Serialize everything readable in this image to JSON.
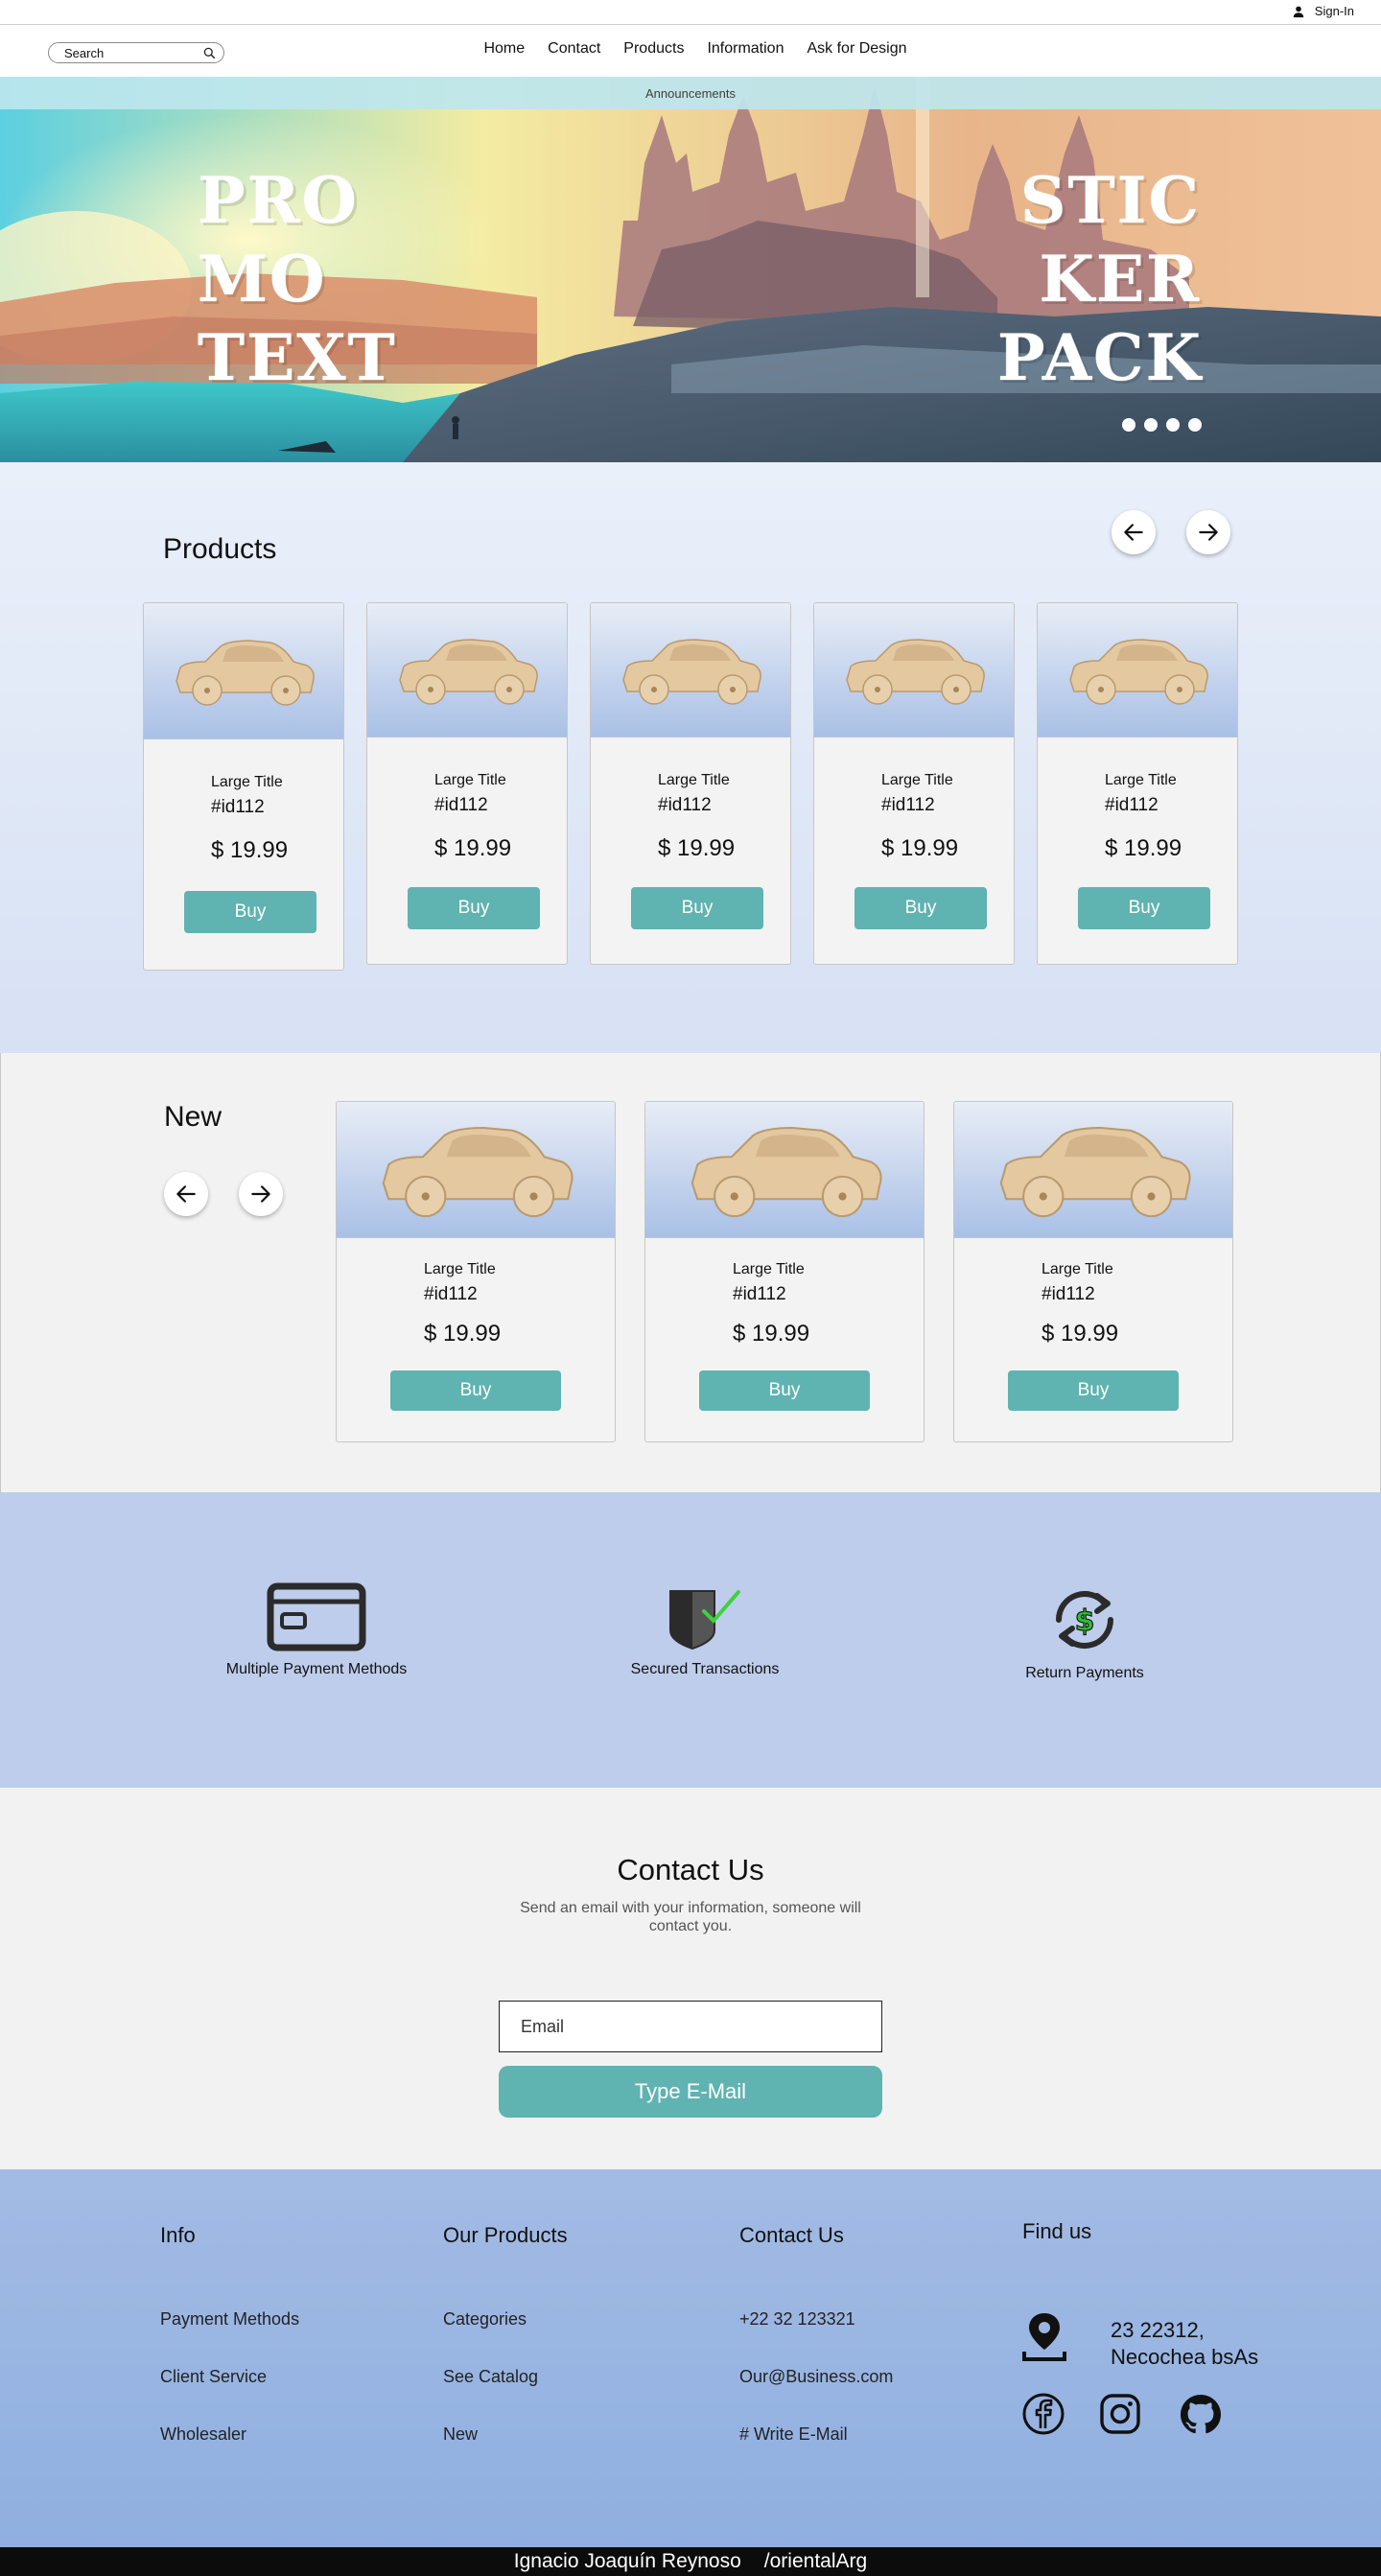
{
  "header": {
    "signin_label": "Sign-In"
  },
  "search": {
    "placeholder": "Search"
  },
  "nav": {
    "items": [
      "Home",
      "Contact",
      "Products",
      "Information",
      "Ask for Design"
    ]
  },
  "announcement": "Announcements",
  "hero": {
    "promo_lines": [
      "PRO",
      "MO",
      "TEXT"
    ],
    "sticker_lines": [
      "STIC",
      "KER",
      "PACK"
    ],
    "slide_count": 4
  },
  "products": {
    "title": "Products",
    "items": [
      {
        "title": "Large Title",
        "id": "#id112",
        "price": "$ 19.99",
        "buy": "Buy"
      },
      {
        "title": "Large Title",
        "id": "#id112",
        "price": "$ 19.99",
        "buy": "Buy"
      },
      {
        "title": "Large Title",
        "id": "#id112",
        "price": "$ 19.99",
        "buy": "Buy"
      },
      {
        "title": "Large Title",
        "id": "#id112",
        "price": "$ 19.99",
        "buy": "Buy"
      },
      {
        "title": "Large Title",
        "id": "#id112",
        "price": "$ 19.99",
        "buy": "Buy"
      }
    ]
  },
  "new": {
    "title": "New",
    "items": [
      {
        "title": "Large Title",
        "id": "#id112",
        "price": "$ 19.99",
        "buy": "Buy"
      },
      {
        "title": "Large Title",
        "id": "#id112",
        "price": "$ 19.99",
        "buy": "Buy"
      },
      {
        "title": "Large Title",
        "id": "#id112",
        "price": "$ 19.99",
        "buy": "Buy"
      }
    ]
  },
  "features": [
    {
      "label": "Multiple Payment Methods",
      "icon": "credit-card-icon"
    },
    {
      "label": "Secured Transactions",
      "icon": "shield-check-icon"
    },
    {
      "label": "Return Payments",
      "icon": "refund-dollar-icon"
    }
  ],
  "contact": {
    "title": "Contact Us",
    "description": "Send an email with your information, someone will contact you.",
    "email_placeholder": "Email",
    "button_label": "Type  E-Mail"
  },
  "footer": {
    "info": {
      "title": "Info",
      "links": [
        "Payment Methods",
        "Client Service",
        "Wholesaler"
      ]
    },
    "products": {
      "title": "Our Products",
      "links": [
        "Categories",
        "See Catalog",
        "New"
      ]
    },
    "contact": {
      "title": "Contact Us",
      "links": [
        "+22 32 123321",
        "Our@Business.com",
        "# Write E-Mail"
      ]
    },
    "find": {
      "title": "Find us",
      "address_line1": "23  22312,",
      "address_line2": "Necochea bsAs"
    }
  },
  "credits": {
    "author": "Ignacio Joaquín Reynoso",
    "handle": "/orientalArg"
  },
  "colors": {
    "buy_button": "#5fb3b1",
    "features_bg": "#bdcdeb",
    "footer_bg": "#9bb5e2"
  }
}
